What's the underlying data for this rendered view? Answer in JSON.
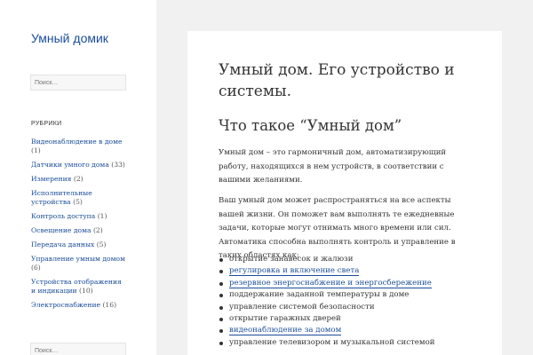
{
  "sidebar": {
    "site_title": "Умный домик",
    "search_placeholder": "Поиск…",
    "categories_heading": "РУБРИКИ",
    "categories": [
      {
        "label": "Видеонаблюдение в доме",
        "count": "(1)"
      },
      {
        "label": "Датчики умного дома",
        "count": "(33)"
      },
      {
        "label": "Измерения",
        "count": "(2)"
      },
      {
        "label": "Исполнительные устройства",
        "count": "(5)"
      },
      {
        "label": "Контроль доступа",
        "count": "(1)"
      },
      {
        "label": "Освещение дома",
        "count": "(2)"
      },
      {
        "label": "Передача данных",
        "count": "(5)"
      },
      {
        "label": "Управление умным домом",
        "count": "(6)"
      },
      {
        "label": "Устройства отображения и индикации",
        "count": "(10)"
      },
      {
        "label": "Электроснабжение",
        "count": "(16)"
      }
    ],
    "search2_placeholder": "Поиск…"
  },
  "article": {
    "title": "Умный дом. Его устройство и системы.",
    "subheading": "Что такое “Умный дом”",
    "paragraph1": "Умный дом – это гармоничный дом, автоматизирующий работу, находящихся в нем устройств, в соответствии с вашими желаниями.",
    "paragraph2": "Ваш умный дом может распространяться на все аспекты вашей жизни. Он поможет вам выполнять те ежедневные задачи, которые могут отнимать много времени или сил. Автоматика способна выполнять контроль и управление в таких областях как:",
    "bullets": [
      {
        "text": "открытие занавесок и жалюзи",
        "link": false
      },
      {
        "text": "регулировка и включение света",
        "link": true
      },
      {
        "text": "резервное энергоснабжение и энергосбережение",
        "link": true
      },
      {
        "text": "поддержание заданной температуры в доме",
        "link": false
      },
      {
        "text": "управление системой безопасности",
        "link": false
      },
      {
        "text": "открытие гаражных дверей",
        "link": false
      },
      {
        "text": "видеонаблюдение за домом",
        "link": true
      },
      {
        "text": "управление телевизором и музыкальной системой",
        "link": false
      }
    ]
  },
  "colors": {
    "link": "#1a4d99",
    "background": "#f1f1f1",
    "panel": "#ffffff",
    "text": "#333333"
  }
}
